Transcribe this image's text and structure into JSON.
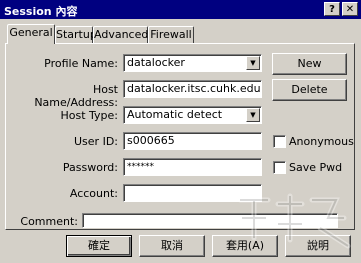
{
  "window": {
    "title": "Session 內容",
    "help_glyph": "?",
    "close_glyph": "✕"
  },
  "tabs": [
    {
      "label": "General"
    },
    {
      "label": "Startup"
    },
    {
      "label": "Advanced"
    },
    {
      "label": "Firewall"
    }
  ],
  "form": {
    "profile_name": {
      "label": "Profile Name:",
      "value": "datalocker"
    },
    "host_name": {
      "label": "Host Name/Address:",
      "value": "datalocker.itsc.cuhk.edu.hk"
    },
    "host_type": {
      "label": "Host Type:",
      "value": "Automatic detect"
    },
    "user_id": {
      "label": "User ID:",
      "value": "s000665"
    },
    "password": {
      "label": "Password:",
      "value": "******"
    },
    "account": {
      "label": "Account:",
      "value": ""
    },
    "comment": {
      "label": "Comment:",
      "value": ""
    },
    "anonymous": {
      "label": "Anonymous",
      "checked": false
    },
    "save_pwd": {
      "label": "Save Pwd",
      "checked": false
    }
  },
  "side_buttons": {
    "new": "New",
    "delete": "Delete"
  },
  "footer_buttons": {
    "ok": "確定",
    "cancel": "取消",
    "apply": "套用(A)",
    "help": "說明"
  },
  "icons": {
    "dropdown": "triangle-down",
    "watermark": "site-logo"
  }
}
